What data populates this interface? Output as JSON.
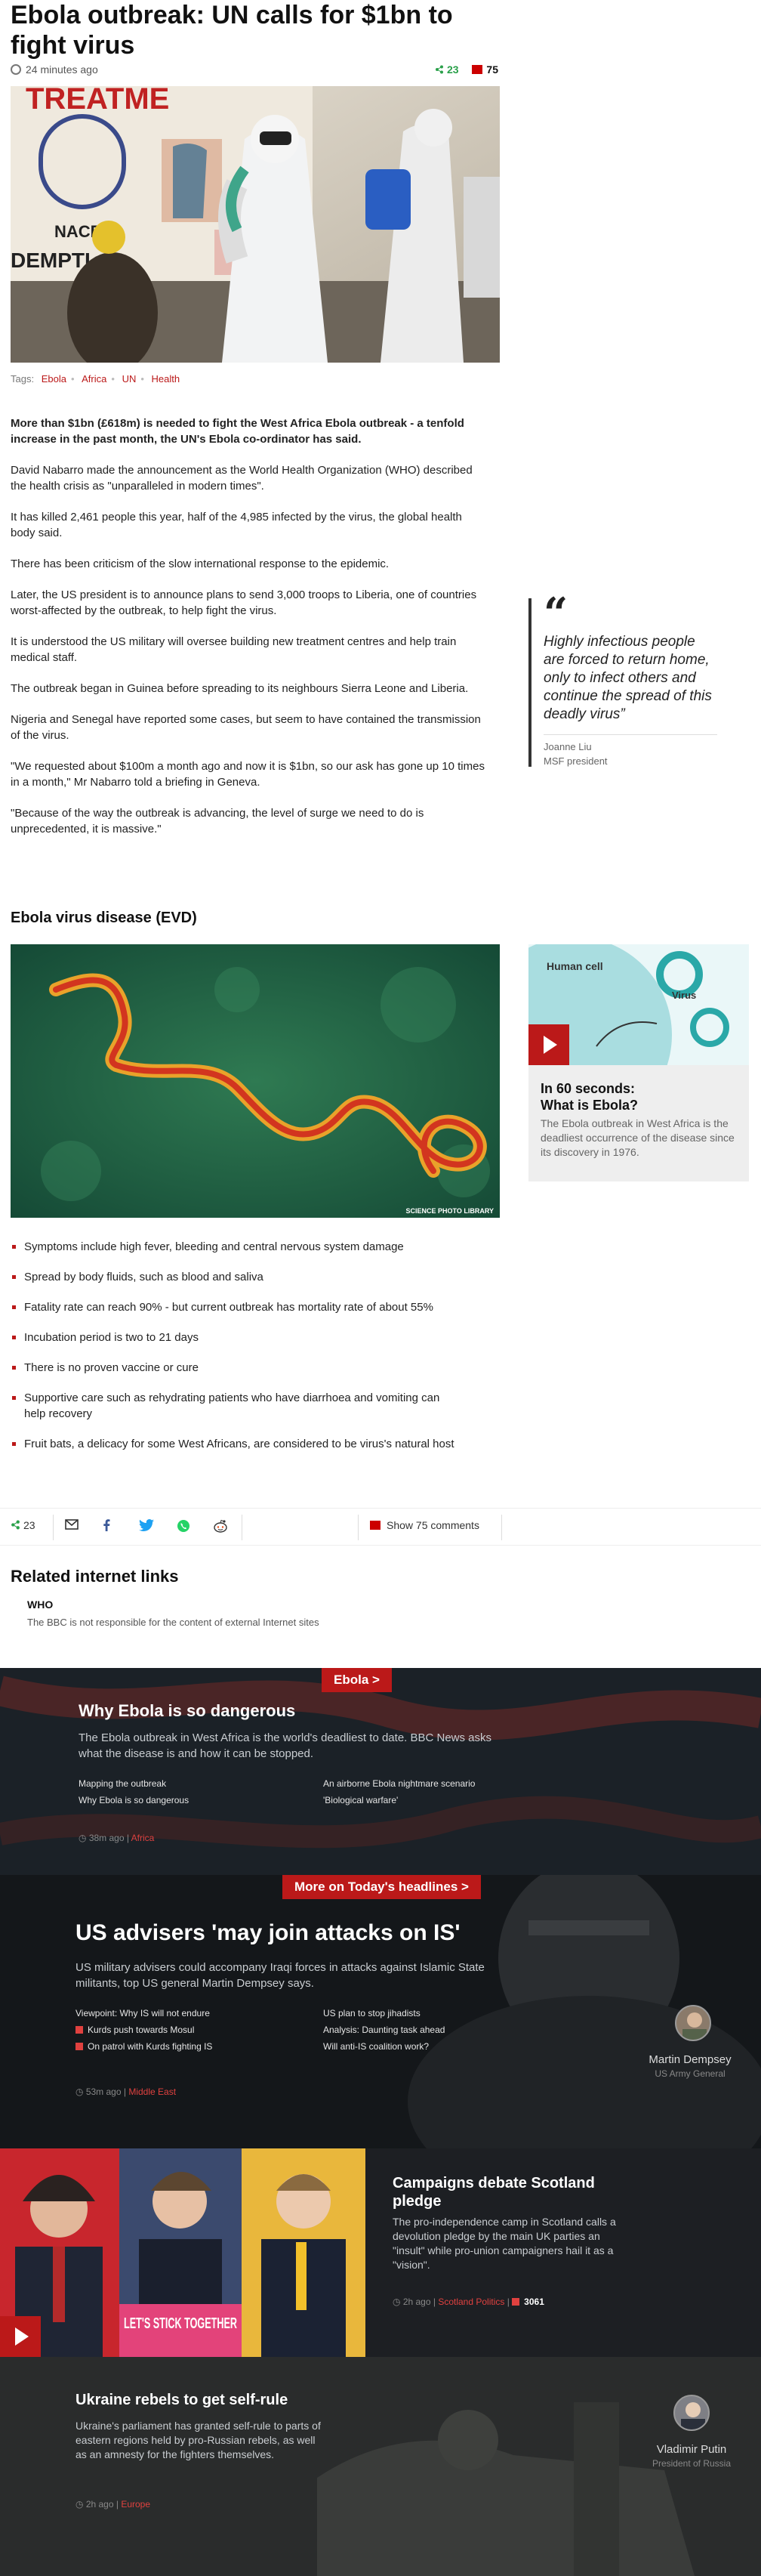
{
  "article": {
    "headline": "Ebola outbreak: UN calls for $1bn to fight virus",
    "time": "24 minutes ago",
    "share_count": "23",
    "comment_count": "75",
    "tags_label": "Tags:",
    "tags": [
      "Ebola",
      "Africa",
      "UN",
      "Health"
    ],
    "paragraphs": [
      "More than $1bn (£618m) is needed to fight the West Africa Ebola outbreak - a tenfold increase in the past month, the UN's Ebola co-ordinator has said.",
      "David Nabarro made the announcement as the World Health Organization (WHO) described the health crisis as \"unparalleled in modern times\".",
      "It has killed 2,461 people this year, half of the 4,985 infected by the virus, the global health body said.",
      "There has been criticism of the slow international response to the epidemic.",
      "Later, the US president is to announce plans to send 3,000 troops to Liberia, one of countries worst-affected by the outbreak, to help fight the virus.",
      "It is understood the US military will oversee building new treatment centres and help train medical staff.",
      "The outbreak began in Guinea before spreading to its neighbours Sierra Leone and Liberia.",
      "Nigeria and Senegal have reported some cases, but seem to have contained the transmission of the virus.",
      "\"We requested about $100m a month ago and now it is $1bn, so our ask has gone up 10 times in a month,\" Mr Nabarro told a briefing in Geneva.",
      "\"Because of the way the outbreak is advancing, the level of surge we need to do is unprecedented, it is massive.\""
    ],
    "hero_sign_text": [
      "TREATME",
      "NACP",
      "DEMPTI"
    ],
    "quote": {
      "mark": "“",
      "text": "Highly infectious people are forced to return home, only to infect others and continue the spread of this deadly virus”",
      "name": "Joanne Liu",
      "role": "MSF president"
    },
    "section_heading": "Ebola virus disease (EVD)",
    "image_credit": "SCIENCE PHOTO LIBRARY",
    "promo": {
      "diagram_label_cell": "Human cell",
      "diagram_label_virus": "Virus",
      "title_line1": "In 60 seconds:",
      "title_line2": "What is Ebola?",
      "desc": "The Ebola outbreak in West Africa is the deadliest occurrence of the disease since its discovery in 1976."
    },
    "bullets": [
      "Symptoms include high fever, bleeding and central nervous system damage",
      "Spread by body fluids, such as blood and saliva",
      "Fatality rate can reach 90% - but current outbreak has mortality rate of about 55%",
      "Incubation period is two to 21 days",
      "There is no proven vaccine or cure",
      "Supportive care such as rehydrating patients who have diarrhoea and vomiting can help recovery",
      "Fruit bats, a delicacy for some West Africans, are considered to be virus's natural host"
    ],
    "share_bar": {
      "share_count": "23",
      "comments_label": "Show 75 comments"
    },
    "related": {
      "heading": "Related internet links",
      "link": "WHO",
      "note": "The BBC is not responsible for the content of external Internet sites"
    }
  },
  "ebola_band": {
    "label": "Ebola >",
    "title": "Why Ebola is so dangerous",
    "desc": "The Ebola outbreak in West Africa is the world's deadliest to date. BBC News asks what the disease is and how it can be stopped.",
    "links": [
      "Mapping the outbreak",
      "Why Ebola is so dangerous",
      "An airborne Ebola nightmare scenario",
      "'Biological warfare'"
    ],
    "time": "38m ago",
    "source": "Africa"
  },
  "headlines_band": {
    "label": "More on Today's headlines >",
    "title": "US advisers 'may join attacks on IS'",
    "desc": "US military advisers could accompany Iraqi forces in attacks against Islamic State militants, top US general Martin Dempsey says.",
    "links": [
      "Viewpoint: Why IS will not endure",
      "Kurds push towards Mosul",
      "On patrol with Kurds fighting IS",
      "US plan to stop jihadists",
      "Analysis: Daunting task ahead",
      "Will anti-IS coalition work?"
    ],
    "time": "53m ago",
    "source": "Middle East",
    "person_name": "Martin Dempsey",
    "person_role": "US Army General"
  },
  "scotland_band": {
    "title": "Campaigns debate Scotland pledge",
    "desc": "The pro-independence camp in Scotland calls a devolution pledge by the main UK parties an \"insult\" while pro-union campaigners hail it as a \"vision\".",
    "time": "2h ago",
    "source": "Scotland Politics",
    "comments": "3061",
    "sign_text": "LET'S STICK TOGETHER"
  },
  "ukraine_band": {
    "title": "Ukraine rebels to get self-rule",
    "desc": "Ukraine's parliament has granted self-rule to parts of eastern regions held by pro-Russian rebels, as well as an amnesty for the fighters themselves.",
    "time": "2h ago",
    "source": "Europe",
    "person_name": "Vladimir Putin",
    "person_role": "President of Russia"
  },
  "colors": {
    "accent": "#bb1919",
    "share_green": "#2aa04a"
  }
}
